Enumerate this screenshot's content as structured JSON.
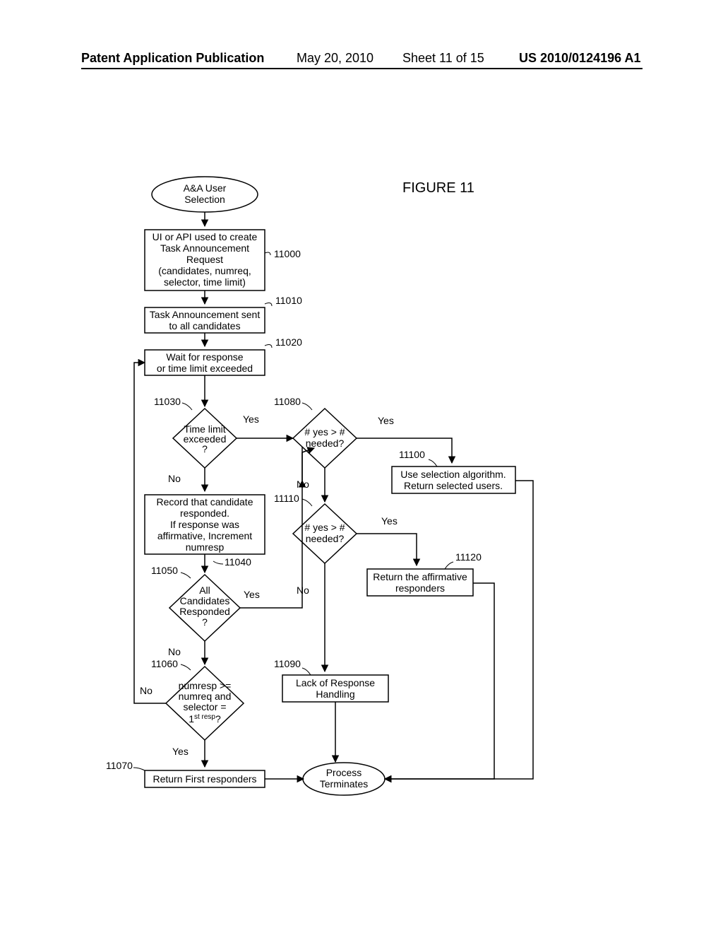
{
  "header": {
    "publication": "Patent Application Publication",
    "date": "May 20, 2010",
    "sheet": "Sheet 11 of 15",
    "pubno": "US 2010/0124196 A1"
  },
  "figure_title": "FIGURE 11",
  "nodes": {
    "start": {
      "l1": "A&A User",
      "l2": "Selection"
    },
    "n11000": {
      "l1": "UI or API used to create",
      "l2": "Task Announcement",
      "l3": "Request",
      "l4": "(candidates, numreq,",
      "l5": "selector, time limit)"
    },
    "n11010": {
      "l1": "Task Announcement sent",
      "l2": "to all candidates"
    },
    "n11020": {
      "l1": "Wait for response",
      "l2": "or time limit exceeded"
    },
    "n11030": {
      "l1": "Time limit",
      "l2": "exceeded",
      "l3": "?"
    },
    "n11040": {
      "l1": "Record that candidate",
      "l2": "responded.",
      "l3": "If response was",
      "l4": "affirmative, Increment",
      "l5": "numresp"
    },
    "n11050": {
      "l1": "All",
      "l2": "Candidates",
      "l3": "Responded",
      "l4": "?"
    },
    "n11060": {
      "l1": "numresp >=",
      "l2": "numreq and",
      "l3": "selector =",
      "l4a": "1",
      "l4b": "st resp",
      "l4c": "?"
    },
    "n11070": {
      "l1": "Return First responders"
    },
    "n11080": {
      "l1": "# yes > #",
      "l2": "needed?"
    },
    "n11090": {
      "l1": "Lack of Response",
      "l2": "Handling"
    },
    "n11100": {
      "l1": "Use selection algorithm.",
      "l2": "Return selected users."
    },
    "n11110": {
      "l1": "# yes > #",
      "l2": "needed?"
    },
    "n11120": {
      "l1": "Return the affirmative",
      "l2": "responders"
    },
    "terminate": {
      "l1": "Process",
      "l2": "Terminates"
    }
  },
  "labels": {
    "yes": "Yes",
    "no": "No"
  },
  "refs": {
    "r11000": "11000",
    "r11010": "11010",
    "r11020": "11020",
    "r11030": "11030",
    "r11040": "11040",
    "r11050": "11050",
    "r11060": "11060",
    "r11070": "11070",
    "r11080": "11080",
    "r11090": "11090",
    "r11100": "11100",
    "r11110": "11110",
    "r11120": "11120"
  }
}
